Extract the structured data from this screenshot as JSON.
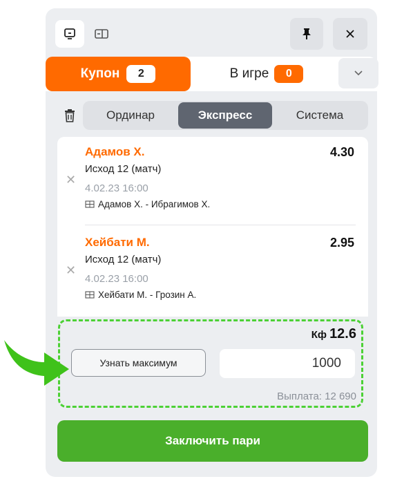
{
  "tabs": {
    "coupon": {
      "label": "Купон",
      "count": "2"
    },
    "in_game": {
      "label": "В игре",
      "count": "0"
    }
  },
  "bet_types": {
    "single": "Ординар",
    "express": "Экспресс",
    "system": "Система",
    "selected": "Экспресс"
  },
  "bets": [
    {
      "name": "Адамов Х.",
      "odd": "4.30",
      "outcome": "Исход 12 (матч)",
      "date": "4.02.23 16:00",
      "match": "Адамов Х. - Ибрагимов Х."
    },
    {
      "name": "Хейбати М.",
      "odd": "2.95",
      "outcome": "Исход 12 (матч)",
      "date": "4.02.23 16:00",
      "match": "Хейбати М. - Грозин А."
    }
  ],
  "summary": {
    "coef_label": "Кф",
    "coef_value": "12.6",
    "max_button": "Узнать максимум",
    "stake": "1000",
    "payout": "Выплата: 12 690"
  },
  "submit_label": "Заключить пари",
  "colors": {
    "accent": "#ff6a00",
    "success": "#4aaf2b",
    "highlight": "#4cd135"
  }
}
